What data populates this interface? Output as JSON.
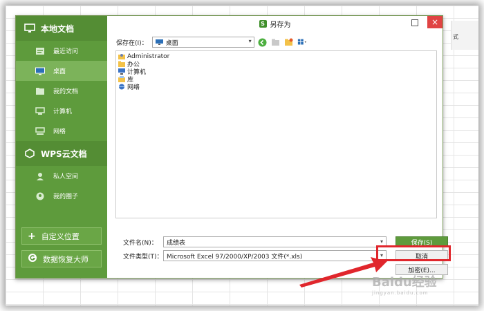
{
  "dialog": {
    "title": "另存为",
    "close_glyph": "×"
  },
  "sidebar": {
    "local": {
      "title": "本地文档",
      "items": [
        {
          "label": "最近访问",
          "icon": "recent-icon"
        },
        {
          "label": "桌面",
          "icon": "desktop-icon",
          "active": true
        },
        {
          "label": "我的文档",
          "icon": "documents-icon"
        },
        {
          "label": "计算机",
          "icon": "computer-icon"
        },
        {
          "label": "网络",
          "icon": "network-icon"
        }
      ]
    },
    "cloud": {
      "title": "WPS云文档",
      "items": [
        {
          "label": "私人空间",
          "icon": "user-icon"
        },
        {
          "label": "我的圈子",
          "icon": "group-icon"
        }
      ]
    },
    "add_location": "自定义位置",
    "recovery": "数据恢复大师"
  },
  "toolbar": {
    "lookin_label": "保存在(I)：",
    "lookin_value": "桌面"
  },
  "files": [
    {
      "name": "Administrator",
      "icon": "user-folder-icon"
    },
    {
      "name": "办公",
      "icon": "folder-icon"
    },
    {
      "name": "计算机",
      "icon": "computer-icon"
    },
    {
      "name": "库",
      "icon": "library-icon"
    },
    {
      "name": "网络",
      "icon": "network-icon"
    }
  ],
  "form": {
    "filename_label": "文件名(N)：",
    "filename_value": "成绩表",
    "filetype_label": "文件类型(T)：",
    "filetype_value": "Microsoft Excel 97/2000/XP/2003 文件(*.xls)"
  },
  "buttons": {
    "save": "保存(S)",
    "cancel": "取消",
    "tools": "加密(E)..."
  },
  "background": {
    "ribbon_text": "式"
  },
  "watermark": {
    "line1": "Baidu经验",
    "line2": "jingyan.baidu.com"
  },
  "colors": {
    "sidebar": "#5e9b3c",
    "highlight": "#e0262c",
    "close": "#e04343"
  }
}
